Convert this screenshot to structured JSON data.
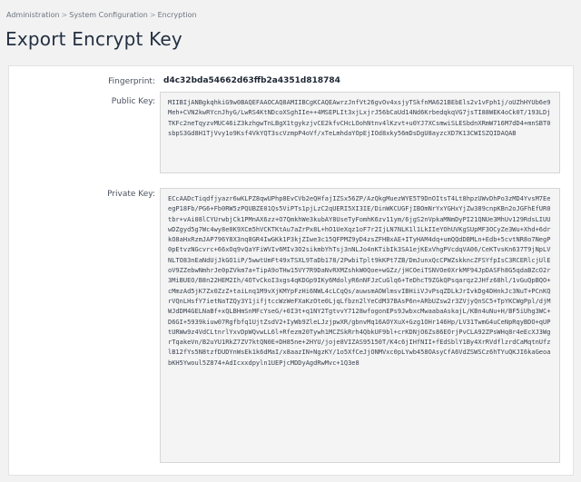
{
  "breadcrumb": {
    "items": [
      "Administration",
      "System Configuration",
      "Encryption"
    ],
    "separator": ">"
  },
  "page_title": "Export Encrypt Key",
  "fields": {
    "fingerprint_label": "Fingerprint:",
    "fingerprint_value": "d4c32bda54662d63ffb2a4351d818784",
    "public_key_label": "Public Key:",
    "public_key_value": "MIIBIjANBgkqhkiG9w0BAQEFAAOCAQ8AMIIBCgKCAQEAwrzJnfVt26gvOv4xsjyTSkfnMA621BEbEls2v1vFph1j/oUZhHYUb6e9Meh+CVN2kwRYcnJhyG/LwRS4KtNDcoXSghIIe++4MSEPLIt3xjLxjrJ56bCaUd14Nd6KrbedqkqVG7jsTI88WEK4oCk0T/193LDjTKFc2neTqyzvMUC46iZ3kzhgwTnLBgX1tgykzjvCE2kfvCHcLOohNtnv4lKzvt+u0YJ7XCsmwiSLESbdnXRmW716M7dD4+mnSBT0sbpS3Gd8H1TjVvy1o9Ksf4VkYQT3scVzmpP4oVf/xTeLmhdaYOpEjIOd8xky56mDsDgU8ayzcXD7K13CWISZQIDAQAB",
    "private_key_label": "Private Key:",
    "private_key_value": "ECcAADcTiqdfjyazr6wKLPZ8qwUPhp8EvCVb2eQHfajIZSx56ZP/AzQkgMuezWYE5T9DnOItsT4Lt8hpzUWvDhPo3zMD4YvsM7EeegP18Fb/PG6+Fb0RW5zPQUBZE01Qs5ViPTs1pjLzC2qUERI5XI3IE/DinWKCUGFjIBOmNrYxYGHxYjZw389cnpKBn2oJGFhEfUR0tbr+vAi08lCYUrwbjCk1PMnAX6zz+O7QmkhWe3kubAY8UseTyFomhK6zv11ym/6jgS2nVpkaMNmDyPI21QNUe3MhUv129RdsLIUUwDZgyd5g7Wc4wy8e0K9XCm5hVCKTKtAu7aZrPx8L+hO1UeXqz1oF7r2IjLN7NLK1l1LkIIeYOhUVKgSUpMF3OCyZe3Wu+Xhd+6dr kO8aHxRzmJAP796Y8X3nq8GR4IwGKk1P3kjZIwe3c15QFPMZ9yD4zsZFHBxAE+ITyHAM4dq+umQQdDBMLn+Edb+5cvtNR8o7NegP0pEtvzNGcvrc+66xOq9vQaYFiWVIv6MIv3O2sikmbYhTsj3nNLJo4nKTibIk3SA1ejKExVhgPVcdqVA06/CeKTvsKn637T9jNpLVNLTO83nEaNdUjJkGO1iP/5wwtUmFt49xTSXL9TaDb178/2PwbiTplt9kKPt7ZB/DmJunxQcCPWZskkncZFSYfpIsC3RCERlcjUlEoV9ZZebwNmhrJe0pZVkm7a+TipA9oTHw15VY7R9DaNvRXMZshkW0Qoe+wGZz/jHCOeiTSNVOe0XrkMF94JpDASFh8G5qdaBZcO2r3MiBUEO/B8n22HEM2Ih/4OTvCkoI3xgs4qKDGp9IKy6MdolyR6nNFJzCuGlq6+TeDhcT9ZGkQPsqarqz2JHfz68hl/1vGuQpBQO+cMmzAd5jK7Zx0ZzZ+taiLnq1M9vXjKMYpFzHi6NWL4cLCqQs/auwsmAOWlmsvIBHiiVJvPsqZDLkJrIvkDg4DHnkJc3NuT+PCnKQrVQnLHsfY7ietNaTZQy3Y1jifjtccWzWeFXaKzOte0LjqLfbzn2lYeCdM37BAsP6n+ARbUZsw2r3ZVjyQnSC5+TpYKCWgPpl/djMWJdDM4GELNaBf+xQLBHmSnMFcYseG/+0I3t+q1NY2TgtvvY7128wfogonEPs9JwbxcMwaabaAskajL/KBn4uNu+H/BF5iUhg3WC+D6GI+5939kiuw07Rgfbfq1UjtZsdV2+IyWb9ZleLJzjpwXR/gbnvMq16AOYXuX+Gzg1OHr146Hp/LV31TwmG4uCeNpRqyBDO+qUPtURWw9z4VdCLtnrlYxvDpWQvwLL6l+Rfezm20Tywh1MCZSkRrh4QbkUF9bl+crKDNjO6Zs86EOrjPvCLA92ZPsWHq8r4eEcXJ3WgrTqakeVn/B2uYU1RkZ7ZV7ktQN0E+DH85ne+2HYU/joje8VIZAS95150T/K4c6jIHfNII+fEdSblY1By4XrRVdflzrdCaMqtnUfzlB12fYs5N8tzfDUDYnWsEk1k6dMaI/x8aazIN+NgzKY/1o5XfCeJjONMVxc0pLYwb458OAsyCfA6VdZSWSCz6hTYuQKJI6kaGeoabKH5Ywoul5Z874+AdIcxxdpyln1UEPjcMDDyAgdRwMvc+1Q3e8"
  }
}
